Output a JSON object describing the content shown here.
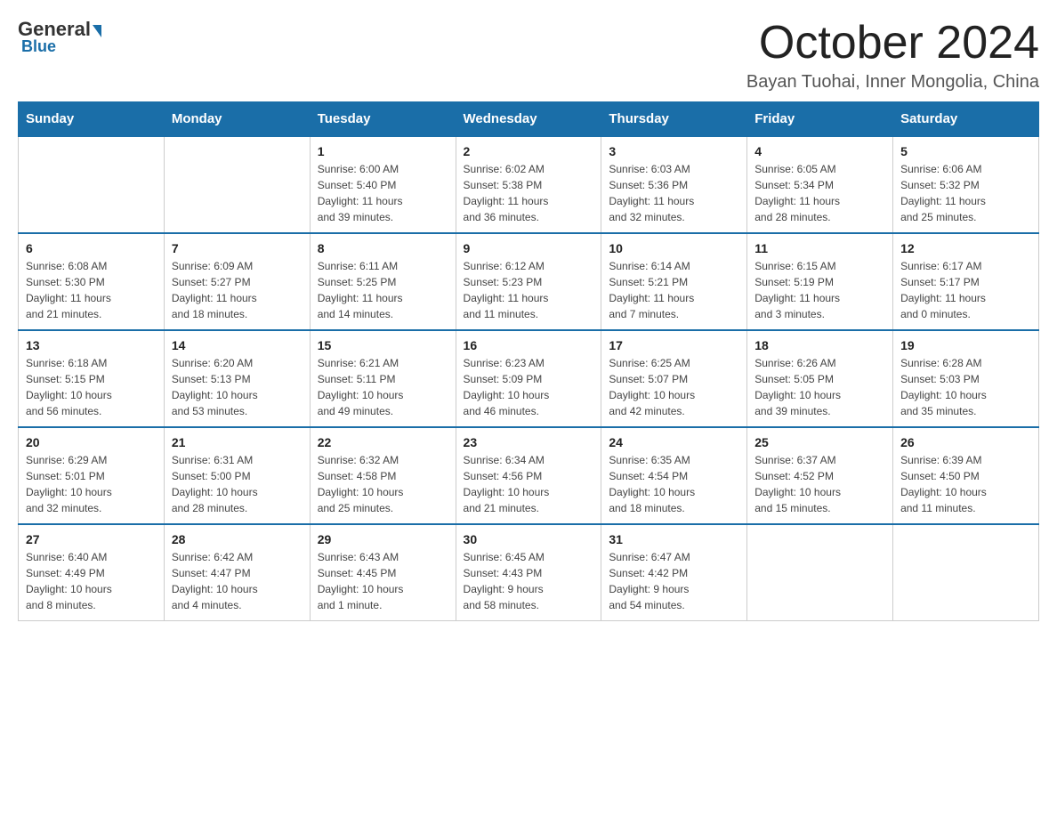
{
  "logo": {
    "general": "General",
    "blue": "Blue"
  },
  "header": {
    "month_title": "October 2024",
    "subtitle": "Bayan Tuohai, Inner Mongolia, China"
  },
  "days_of_week": [
    "Sunday",
    "Monday",
    "Tuesday",
    "Wednesday",
    "Thursday",
    "Friday",
    "Saturday"
  ],
  "weeks": [
    [
      {
        "num": "",
        "info": ""
      },
      {
        "num": "",
        "info": ""
      },
      {
        "num": "1",
        "info": "Sunrise: 6:00 AM\nSunset: 5:40 PM\nDaylight: 11 hours\nand 39 minutes."
      },
      {
        "num": "2",
        "info": "Sunrise: 6:02 AM\nSunset: 5:38 PM\nDaylight: 11 hours\nand 36 minutes."
      },
      {
        "num": "3",
        "info": "Sunrise: 6:03 AM\nSunset: 5:36 PM\nDaylight: 11 hours\nand 32 minutes."
      },
      {
        "num": "4",
        "info": "Sunrise: 6:05 AM\nSunset: 5:34 PM\nDaylight: 11 hours\nand 28 minutes."
      },
      {
        "num": "5",
        "info": "Sunrise: 6:06 AM\nSunset: 5:32 PM\nDaylight: 11 hours\nand 25 minutes."
      }
    ],
    [
      {
        "num": "6",
        "info": "Sunrise: 6:08 AM\nSunset: 5:30 PM\nDaylight: 11 hours\nand 21 minutes."
      },
      {
        "num": "7",
        "info": "Sunrise: 6:09 AM\nSunset: 5:27 PM\nDaylight: 11 hours\nand 18 minutes."
      },
      {
        "num": "8",
        "info": "Sunrise: 6:11 AM\nSunset: 5:25 PM\nDaylight: 11 hours\nand 14 minutes."
      },
      {
        "num": "9",
        "info": "Sunrise: 6:12 AM\nSunset: 5:23 PM\nDaylight: 11 hours\nand 11 minutes."
      },
      {
        "num": "10",
        "info": "Sunrise: 6:14 AM\nSunset: 5:21 PM\nDaylight: 11 hours\nand 7 minutes."
      },
      {
        "num": "11",
        "info": "Sunrise: 6:15 AM\nSunset: 5:19 PM\nDaylight: 11 hours\nand 3 minutes."
      },
      {
        "num": "12",
        "info": "Sunrise: 6:17 AM\nSunset: 5:17 PM\nDaylight: 11 hours\nand 0 minutes."
      }
    ],
    [
      {
        "num": "13",
        "info": "Sunrise: 6:18 AM\nSunset: 5:15 PM\nDaylight: 10 hours\nand 56 minutes."
      },
      {
        "num": "14",
        "info": "Sunrise: 6:20 AM\nSunset: 5:13 PM\nDaylight: 10 hours\nand 53 minutes."
      },
      {
        "num": "15",
        "info": "Sunrise: 6:21 AM\nSunset: 5:11 PM\nDaylight: 10 hours\nand 49 minutes."
      },
      {
        "num": "16",
        "info": "Sunrise: 6:23 AM\nSunset: 5:09 PM\nDaylight: 10 hours\nand 46 minutes."
      },
      {
        "num": "17",
        "info": "Sunrise: 6:25 AM\nSunset: 5:07 PM\nDaylight: 10 hours\nand 42 minutes."
      },
      {
        "num": "18",
        "info": "Sunrise: 6:26 AM\nSunset: 5:05 PM\nDaylight: 10 hours\nand 39 minutes."
      },
      {
        "num": "19",
        "info": "Sunrise: 6:28 AM\nSunset: 5:03 PM\nDaylight: 10 hours\nand 35 minutes."
      }
    ],
    [
      {
        "num": "20",
        "info": "Sunrise: 6:29 AM\nSunset: 5:01 PM\nDaylight: 10 hours\nand 32 minutes."
      },
      {
        "num": "21",
        "info": "Sunrise: 6:31 AM\nSunset: 5:00 PM\nDaylight: 10 hours\nand 28 minutes."
      },
      {
        "num": "22",
        "info": "Sunrise: 6:32 AM\nSunset: 4:58 PM\nDaylight: 10 hours\nand 25 minutes."
      },
      {
        "num": "23",
        "info": "Sunrise: 6:34 AM\nSunset: 4:56 PM\nDaylight: 10 hours\nand 21 minutes."
      },
      {
        "num": "24",
        "info": "Sunrise: 6:35 AM\nSunset: 4:54 PM\nDaylight: 10 hours\nand 18 minutes."
      },
      {
        "num": "25",
        "info": "Sunrise: 6:37 AM\nSunset: 4:52 PM\nDaylight: 10 hours\nand 15 minutes."
      },
      {
        "num": "26",
        "info": "Sunrise: 6:39 AM\nSunset: 4:50 PM\nDaylight: 10 hours\nand 11 minutes."
      }
    ],
    [
      {
        "num": "27",
        "info": "Sunrise: 6:40 AM\nSunset: 4:49 PM\nDaylight: 10 hours\nand 8 minutes."
      },
      {
        "num": "28",
        "info": "Sunrise: 6:42 AM\nSunset: 4:47 PM\nDaylight: 10 hours\nand 4 minutes."
      },
      {
        "num": "29",
        "info": "Sunrise: 6:43 AM\nSunset: 4:45 PM\nDaylight: 10 hours\nand 1 minute."
      },
      {
        "num": "30",
        "info": "Sunrise: 6:45 AM\nSunset: 4:43 PM\nDaylight: 9 hours\nand 58 minutes."
      },
      {
        "num": "31",
        "info": "Sunrise: 6:47 AM\nSunset: 4:42 PM\nDaylight: 9 hours\nand 54 minutes."
      },
      {
        "num": "",
        "info": ""
      },
      {
        "num": "",
        "info": ""
      }
    ]
  ]
}
